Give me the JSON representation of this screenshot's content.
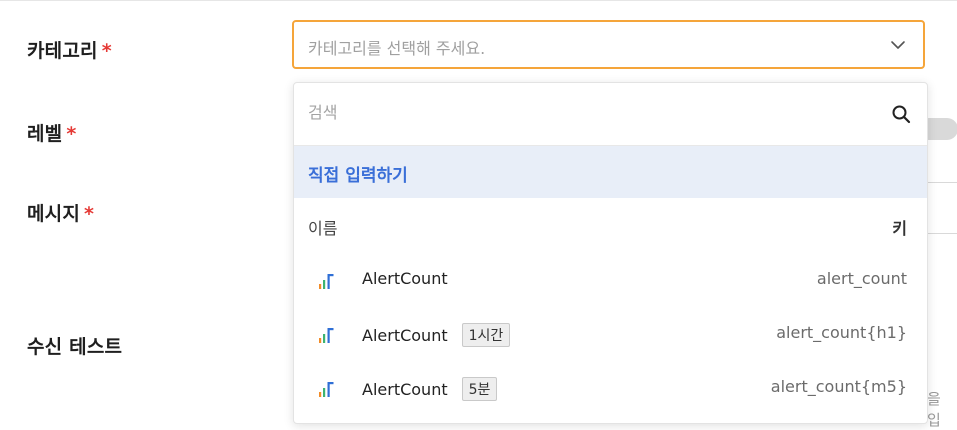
{
  "form": {
    "category_label": "카테고리",
    "level_label": "레벨",
    "message_label": "메시지",
    "test_label": "수신 테스트",
    "required_mark": "*"
  },
  "category_select": {
    "placeholder": "카테고리를 선택해 주세요.",
    "chevron_icon": "chevron-down-icon",
    "border_color": "#f5a53a"
  },
  "dropdown": {
    "search_placeholder": "검색",
    "search_icon": "search-icon",
    "direct_input_label": "직접 입력하기",
    "direct_input_bg": "#e8eef8",
    "direct_input_color": "#3a6fd8",
    "header": {
      "name": "이름",
      "key": "키"
    },
    "items": [
      {
        "name": "AlertCount",
        "tag": "",
        "key": "alert_count",
        "icon": "metric-chart-icon"
      },
      {
        "name": "AlertCount",
        "tag": "1시간",
        "key": "alert_count{h1}",
        "icon": "metric-chart-icon"
      },
      {
        "name": "AlertCount",
        "tag": "5분",
        "key": "alert_count{m5}",
        "icon": "metric-chart-icon"
      }
    ]
  },
  "background": {
    "partial_text": "을 입"
  },
  "colors": {
    "required": "#e53935",
    "icon_orange": "#f28c28",
    "icon_green": "#3cb371",
    "icon_blue": "#2f6fd6"
  }
}
